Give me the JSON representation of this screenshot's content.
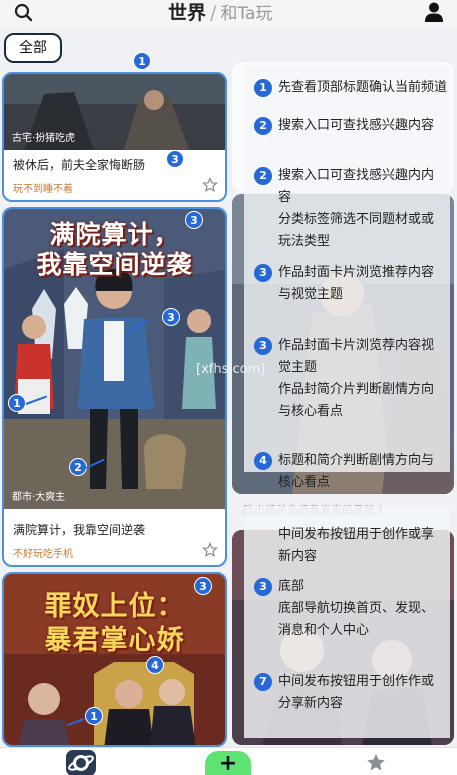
{
  "header": {
    "title_main": "世界",
    "separator": "/",
    "title_sub": "和Ta玩"
  },
  "filter": {
    "all_label": "全部"
  },
  "cards": [
    {
      "cover_tag": "古宅·扮猪吃虎",
      "title": "被休后，前夫全家悔断肠",
      "subtitle": "玩不到睡不着"
    },
    {
      "cover_text_line1": "满院算计，",
      "cover_text_line2": "我靠空间逆袭",
      "cover_tag": "都市·大爽主",
      "title": "满院算计，我靠空间逆袭",
      "subtitle": "不好玩吃手机"
    },
    {
      "cover_text_line1": "罪奴上位：",
      "cover_text_line2": "暴君掌心娇"
    }
  ],
  "right_column": {
    "card2_caption": "跳出婚杀岛后我发家妈是猎人"
  },
  "tips": [
    {
      "badge": "1",
      "text": "先查看顶部标题确认当前频道"
    },
    {
      "badge": "2",
      "text": "搜索入口可查找感兴趣内容"
    },
    {
      "badge": "2",
      "text": "搜索入口可查找感兴趣内内容"
    },
    {
      "badge": "",
      "text": "分类标签筛选不同题材或或玩法类型"
    },
    {
      "badge": "3",
      "text": "作品封面卡片浏览推荐内容与视觉主题"
    },
    {
      "badge": "3",
      "text": "作品封面卡片浏览荐内容视觉主题"
    },
    {
      "badge": "",
      "text": "作品封简介片判断剧情方向与核心看点"
    },
    {
      "badge": "4",
      "text": "标题和简介判断剧情方向与核心看点"
    },
    {
      "badge": "",
      "text": "中间发布按钮用于创作或享新内容"
    },
    {
      "badge": "3",
      "text": "底部"
    },
    {
      "badge": "",
      "text": "底部导航切换首页、发现、消息和个人中心"
    },
    {
      "badge": "7",
      "text": "中间发布按钮用于创作作或分享新内容"
    }
  ],
  "left_badges": [
    "1",
    "3",
    "3",
    "3",
    "1",
    "2",
    "3",
    "4",
    "1"
  ],
  "watermark": "[xfhs.com]",
  "bottom_nav": {
    "add_label": "+"
  },
  "colors": {
    "accent": "#2668d8",
    "card_border": "#4a90e2",
    "subtitle": "#c77b32",
    "add_button": "#5ee271"
  }
}
